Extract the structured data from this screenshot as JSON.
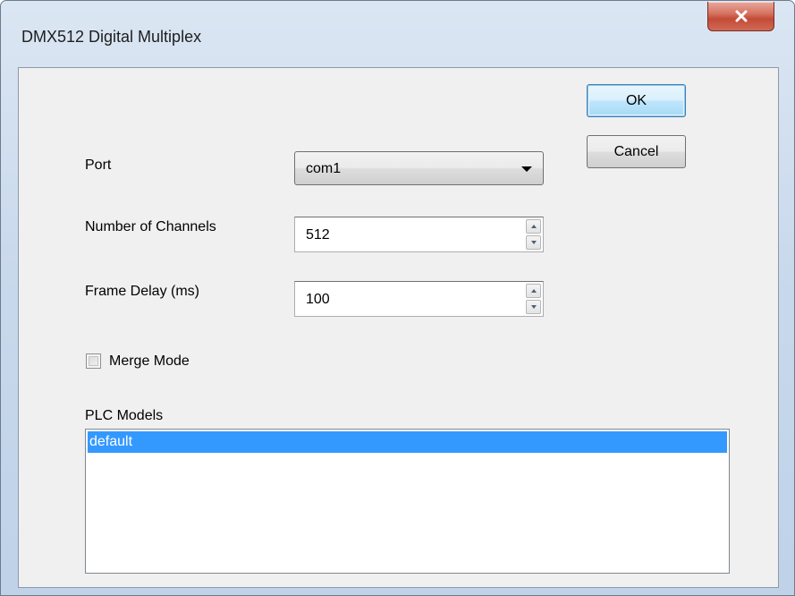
{
  "window": {
    "title": "DMX512 Digital Multiplex",
    "close_icon": "close-x-icon"
  },
  "buttons": {
    "ok": "OK",
    "cancel": "Cancel"
  },
  "fields": {
    "port": {
      "label": "Port",
      "value": "com1"
    },
    "channels": {
      "label": "Number of Channels",
      "value": "512"
    },
    "frame_delay": {
      "label": "Frame Delay (ms)",
      "value": "100"
    }
  },
  "merge_mode": {
    "label": "Merge Mode",
    "checked": false
  },
  "plc_models": {
    "label": "PLC Models",
    "items": [
      {
        "label": "default",
        "selected": true
      }
    ]
  },
  "colors": {
    "selection": "#3399ff",
    "close_button": "#c24b37",
    "frame": "#c9d9ec"
  }
}
